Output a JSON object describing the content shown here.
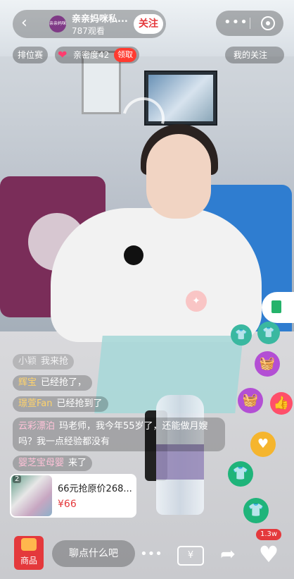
{
  "header": {
    "room_name": "亲亲妈咪私...",
    "avatar_text": "亲亲妈咪",
    "viewers": "787观看",
    "follow_label": "关注"
  },
  "chips": {
    "ranking": "排位赛",
    "intimacy": "亲密度42",
    "claim": "领取",
    "my_following": "我的关注"
  },
  "comments": [
    {
      "user": "小颖",
      "text": "我来抢"
    },
    {
      "user": "辉宝",
      "text": "已经抢了，"
    },
    {
      "user": "璟萱Fan",
      "text": "已经抢到了"
    },
    {
      "user": "云彩漂泊",
      "text": "玛老师，我今年55岁了，还能做月嫂吗？我一点经验都没有"
    },
    {
      "user": "婴芝宝母婴",
      "text": "来了"
    }
  ],
  "product": {
    "index": "2",
    "title": "66元抢原价268...",
    "price": "¥66"
  },
  "bottom": {
    "shop_label": "商品",
    "chat_placeholder": "聊点什么吧",
    "red_packet_symbol": "¥",
    "like_count": "1.3w"
  },
  "colors": {
    "accent_red": "#e4393c",
    "claim_red": "#ff3b30",
    "brand_purple": "#7a2d59"
  },
  "icons": {
    "back": "back-icon",
    "more": "more-icon",
    "close": "close-mini-icon",
    "heart": "heart-icon",
    "share": "share-icon",
    "like": "like-icon"
  }
}
